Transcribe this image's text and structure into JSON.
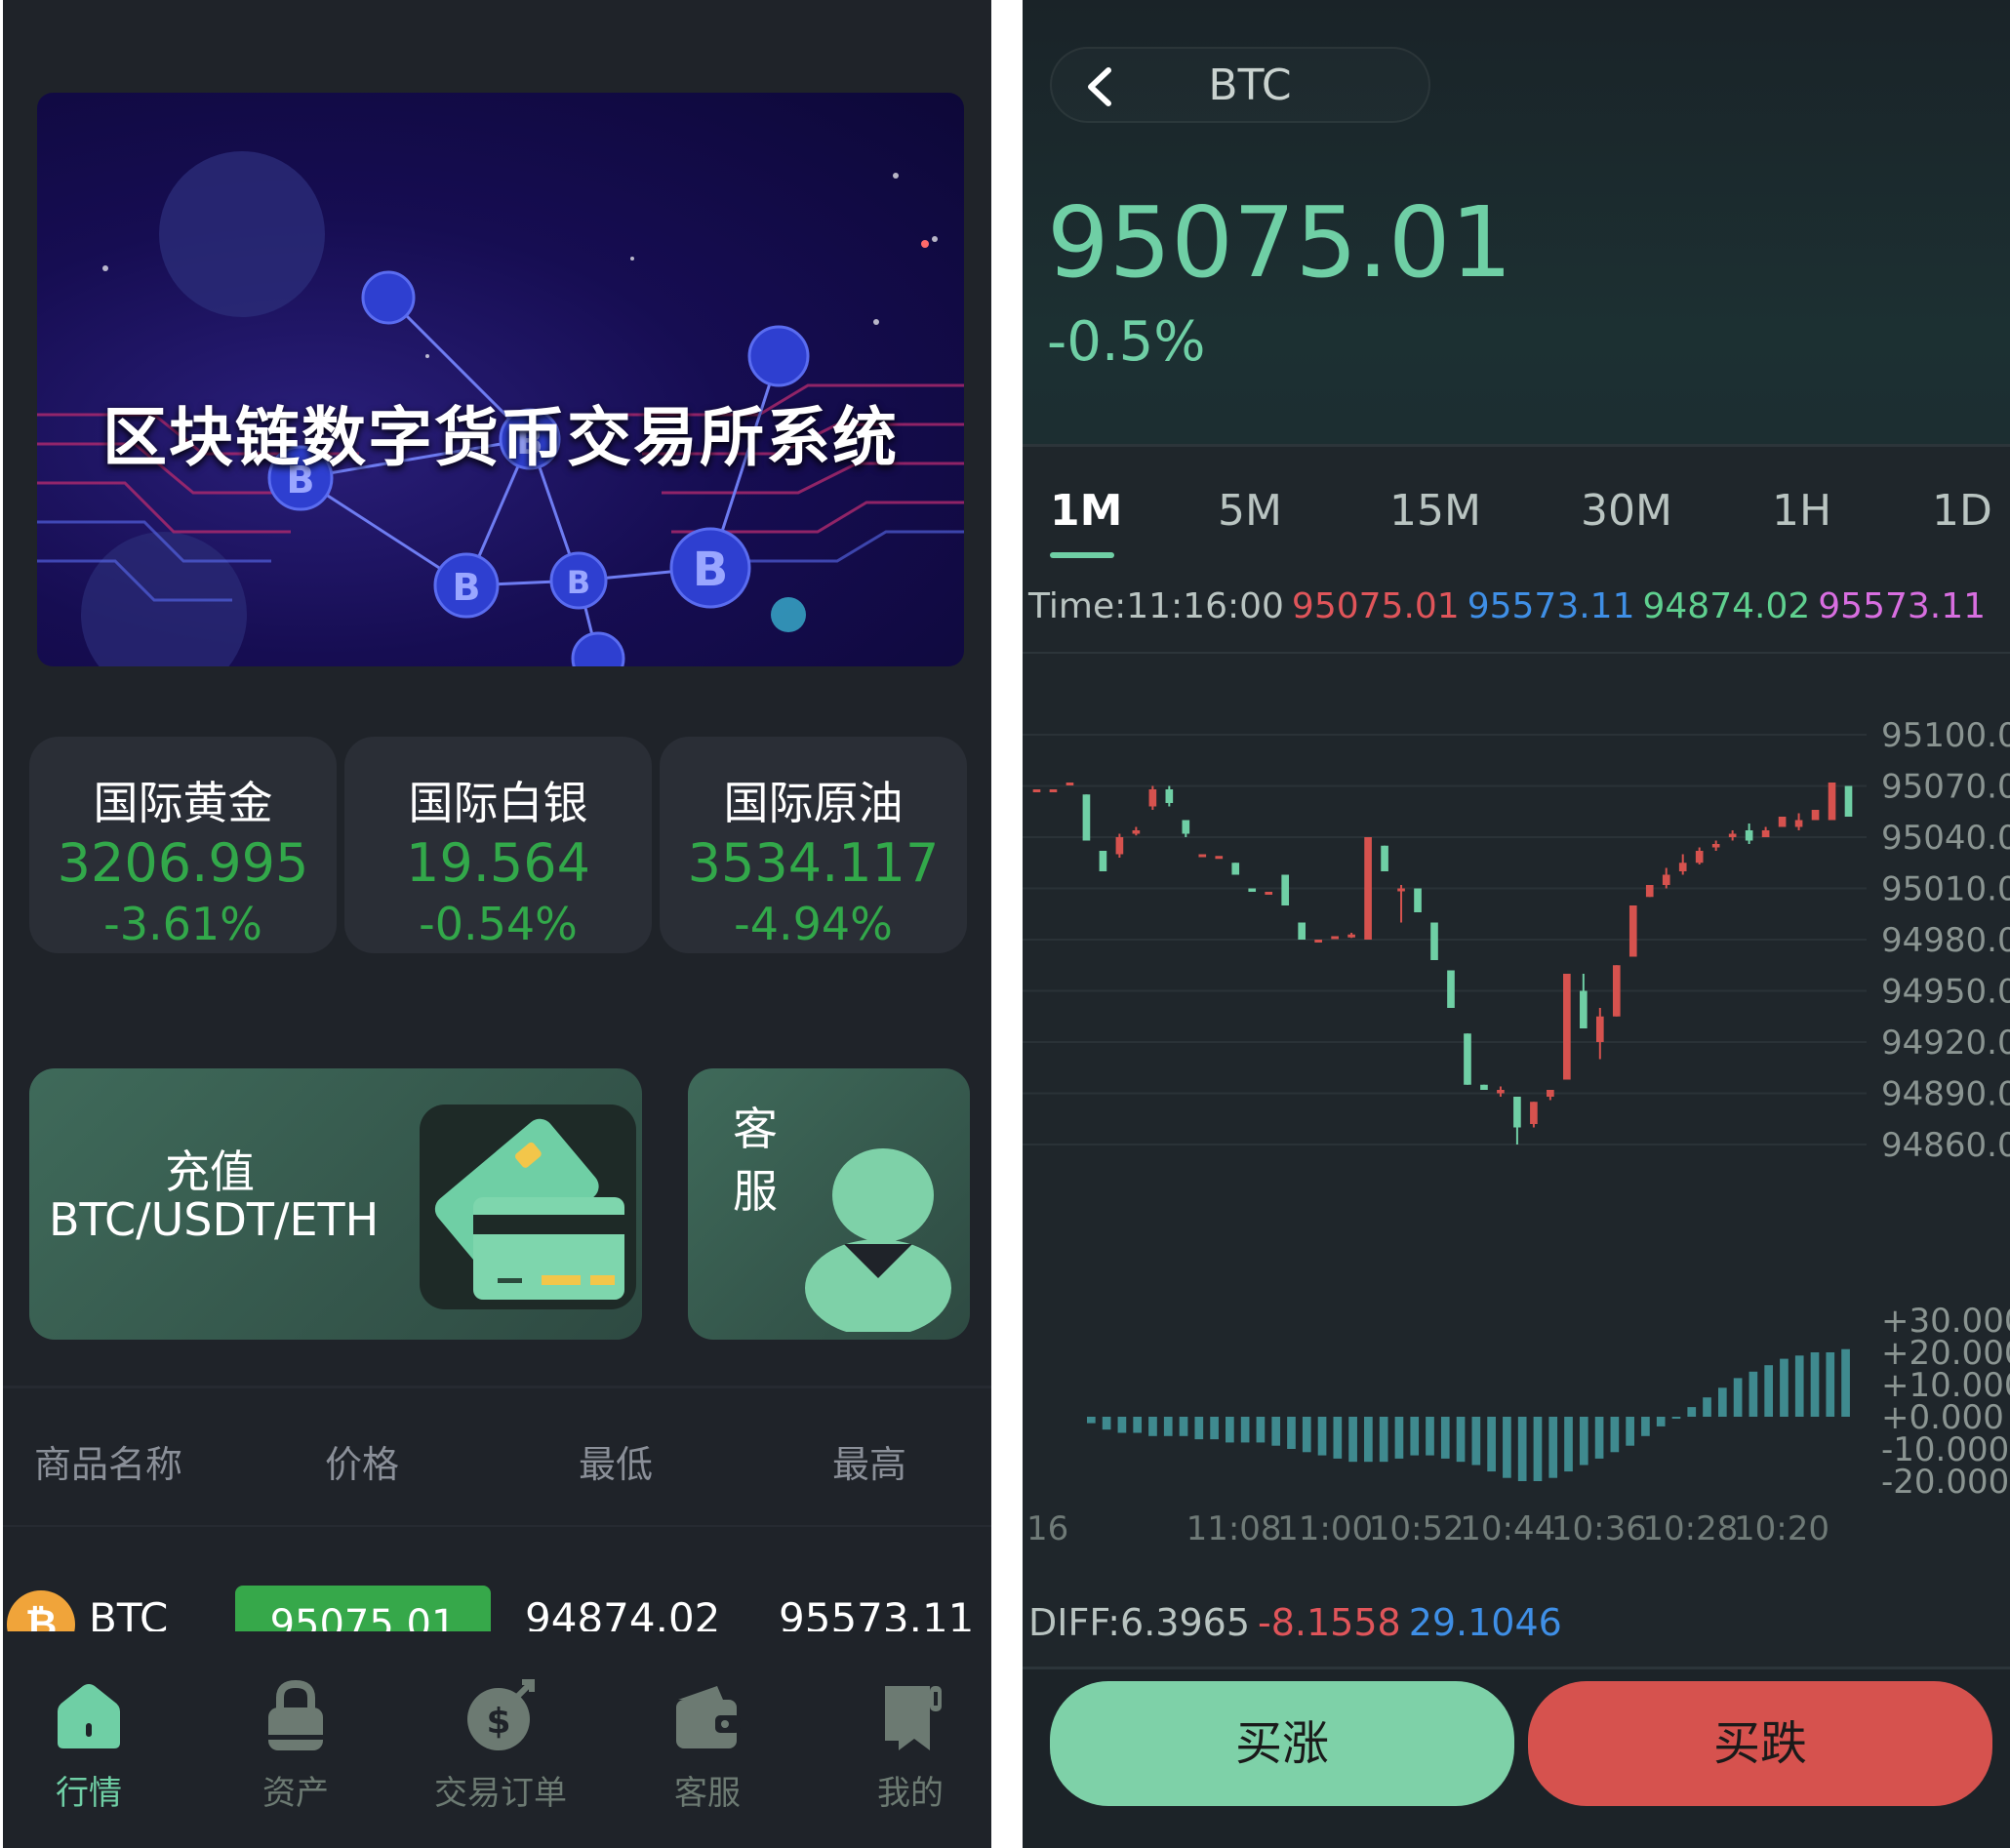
{
  "home": {
    "banner_title": "区块链数字货币交易所系统",
    "markets": [
      {
        "name": "国际黄金",
        "price": "3206.995",
        "change": "-3.61%"
      },
      {
        "name": "国际白银",
        "price": "19.564",
        "change": "-0.54%"
      },
      {
        "name": "国际原油",
        "price": "3534.117",
        "change": "-4.94%"
      }
    ],
    "deposit": {
      "line1": "充值",
      "line2": "BTC/USDT/ETH"
    },
    "service_label": "客服",
    "table_headers": [
      "商品名称",
      "价格",
      "最低",
      "最高"
    ],
    "rows": [
      {
        "coin_glyph": "₿",
        "name": "BTC",
        "price": "95075.01",
        "low": "94874.02",
        "high": "95573.11"
      }
    ],
    "tabs": [
      {
        "label": "行情",
        "icon": "home-icon"
      },
      {
        "label": "资产",
        "icon": "lock-icon"
      },
      {
        "label": "交易订单",
        "icon": "dollar-bag-icon"
      },
      {
        "label": "客服",
        "icon": "wallet-icon"
      },
      {
        "label": "我的",
        "icon": "book-icon"
      }
    ],
    "active_tab": "行情"
  },
  "detail": {
    "pair": "BTC",
    "price": "95075.01",
    "change": "-0.5%",
    "intervals": [
      "1M",
      "5M",
      "15M",
      "30M",
      "1H",
      "1D"
    ],
    "active_interval": "1M",
    "ohlc": {
      "time": "Time:11:16:00",
      "open": "95075.01",
      "high": "95573.11",
      "low": "94874.02",
      "close": "95573.11"
    },
    "diff": {
      "label": "DIFF:6.3965",
      "v2": "-8.1558",
      "v3": "29.1046"
    },
    "buy_up": "买涨",
    "buy_down": "买跌"
  },
  "colors": {
    "up_green": "#6fcfa5",
    "down_red": "#d6524e",
    "market_green": "#32a84a",
    "ohlc_open": "#e0555a",
    "ohlc_high": "#3f8fe6",
    "ohlc_low": "#5fd08f",
    "ohlc_close": "#d86ee0"
  },
  "chart_data": {
    "type": "candlestick",
    "y_ticks": [
      "95100.0",
      "95070.0",
      "95040.0",
      "95010.0",
      "94980.0",
      "94950.0",
      "94920.0",
      "94890.0",
      "94860.0"
    ],
    "ylim": [
      94860,
      95100
    ],
    "x_ticks": [
      "16",
      "11:08",
      "11:00",
      "10:52",
      "10:44",
      "10:36",
      "10:28",
      "10:20"
    ],
    "macd_ticks": [
      "+30.000",
      "+20.000",
      "+10.000",
      "+0.000",
      "-10.000",
      "-20.000"
    ],
    "macd_ylim": [
      -20,
      30
    ],
    "candles": [
      [
        95068,
        95068,
        95068,
        95068
      ],
      [
        95068,
        95068,
        95068,
        95068
      ],
      [
        95072,
        95072,
        95072,
        95072
      ],
      [
        95065,
        95038,
        95065,
        95038
      ],
      [
        95032,
        95020,
        95032,
        95020
      ],
      [
        95030,
        95040,
        95042,
        95028
      ],
      [
        95042,
        95044,
        95046,
        95041
      ],
      [
        95058,
        95068,
        95070,
        95056
      ],
      [
        95068,
        95060,
        95070,
        95058
      ],
      [
        95050,
        95042,
        95050,
        95040
      ],
      [
        95030,
        95030,
        95030,
        95030
      ],
      [
        95029,
        95029,
        95029,
        95029
      ],
      [
        95025,
        95018,
        95025,
        95018
      ],
      [
        95010,
        95008,
        95010,
        95008
      ],
      [
        95008,
        95008,
        95008,
        95008
      ],
      [
        95018,
        95000,
        95018,
        95000
      ],
      [
        94990,
        94980,
        94990,
        94980
      ],
      [
        94980,
        94980,
        94980,
        94980
      ],
      [
        94982,
        94982,
        94982,
        94982
      ],
      [
        94982,
        94983,
        94984,
        94981
      ],
      [
        94980,
        95040,
        95040,
        94980
      ],
      [
        95035,
        95020,
        95035,
        95020
      ],
      [
        95010,
        95010,
        95012,
        94990
      ],
      [
        95010,
        94996,
        95010,
        94996
      ],
      [
        94990,
        94968,
        94990,
        94968
      ],
      [
        94962,
        94940,
        94962,
        94940
      ],
      [
        94925,
        94895,
        94925,
        94895
      ],
      [
        94895,
        94892,
        94895,
        94892
      ],
      [
        94890,
        94892,
        94894,
        94888
      ],
      [
        94888,
        94870,
        94888,
        94860
      ],
      [
        94872,
        94885,
        94885,
        94870
      ],
      [
        94888,
        94892,
        94892,
        94886
      ],
      [
        94898,
        94960,
        94960,
        94898
      ],
      [
        94950,
        94928,
        94960,
        94928
      ],
      [
        94920,
        94935,
        94940,
        94910
      ],
      [
        94935,
        94965,
        94965,
        94935
      ],
      [
        94970,
        95000,
        95000,
        94970
      ],
      [
        95005,
        95012,
        95012,
        95005
      ],
      [
        95012,
        95018,
        95022,
        95010
      ],
      [
        95020,
        95025,
        95030,
        95018
      ],
      [
        95025,
        95032,
        95034,
        95024
      ],
      [
        95034,
        95036,
        95038,
        95032
      ],
      [
        95040,
        95042,
        95044,
        95038
      ],
      [
        95044,
        95038,
        95048,
        95036
      ],
      [
        95040,
        95044,
        95046,
        95040
      ],
      [
        95046,
        95052,
        95052,
        95046
      ],
      [
        95046,
        95050,
        95054,
        95044
      ],
      [
        95050,
        95056,
        95056,
        95050
      ],
      [
        95050,
        95072,
        95072,
        95050
      ],
      [
        95070,
        95052,
        95070,
        95052
      ]
    ],
    "macd": [
      -2,
      -4,
      -5,
      -5,
      -6,
      -6,
      -6,
      -7,
      -7,
      -8,
      -8,
      -8,
      -9,
      -10,
      -11,
      -12,
      -13,
      -14,
      -14,
      -14,
      -13,
      -12,
      -12,
      -13,
      -14,
      -15,
      -17,
      -19,
      -20,
      -20,
      -19,
      -17,
      -15,
      -13,
      -11,
      -9,
      -6,
      -3,
      0,
      3,
      6,
      9,
      12,
      14,
      16,
      18,
      19,
      20,
      20,
      21
    ]
  }
}
